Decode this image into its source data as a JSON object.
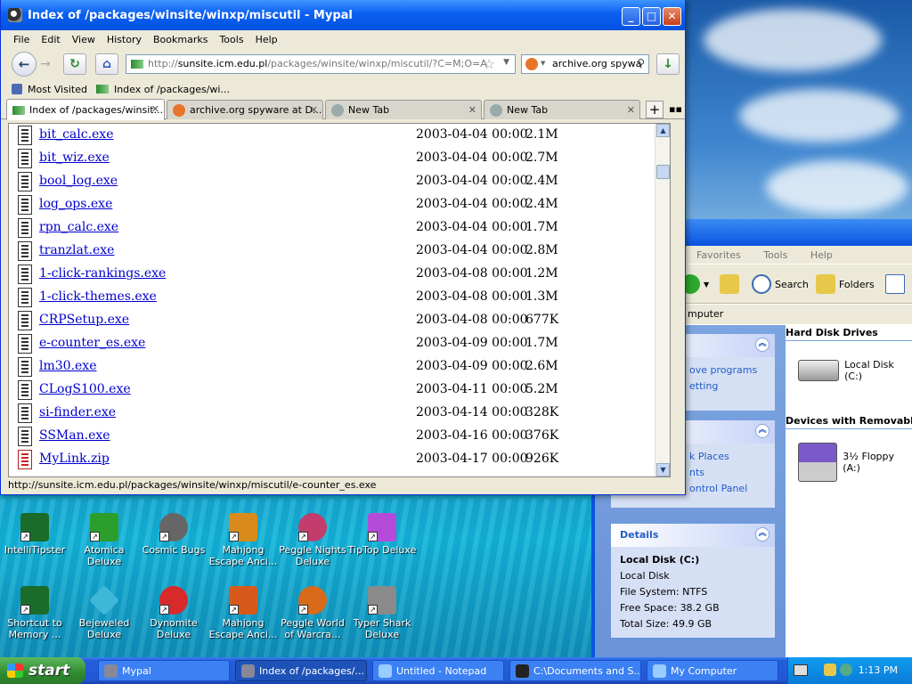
{
  "firefox": {
    "window_title": "Index of /packages/winsite/winxp/miscutil - Mypal",
    "menu": [
      "File",
      "Edit",
      "View",
      "History",
      "Bookmarks",
      "Tools",
      "Help"
    ],
    "url_prefix": "http://",
    "url_host": "sunsite.icm.edu.pl",
    "url_path": "/packages/winsite/winxp/miscutil/?C=M;O=A",
    "search_value": "archive.org spywa",
    "bookmarks": [
      "Most Visited",
      "Index of /packages/wi..."
    ],
    "tabs": [
      {
        "label": "Index of /packages/winsit...",
        "active": true
      },
      {
        "label": "archive.org spyware at D...",
        "active": false
      },
      {
        "label": "New Tab",
        "active": false
      },
      {
        "label": "New Tab",
        "active": false
      }
    ],
    "files": [
      {
        "name": "bit_calc.exe",
        "date": "2003-04-04 00:00",
        "size": "2.1M",
        "kind": "exe"
      },
      {
        "name": "bit_wiz.exe",
        "date": "2003-04-04 00:00",
        "size": "2.7M",
        "kind": "exe"
      },
      {
        "name": "bool_log.exe",
        "date": "2003-04-04 00:00",
        "size": "2.4M",
        "kind": "exe"
      },
      {
        "name": "log_ops.exe",
        "date": "2003-04-04 00:00",
        "size": "2.4M",
        "kind": "exe"
      },
      {
        "name": "rpn_calc.exe",
        "date": "2003-04-04 00:00",
        "size": "1.7M",
        "kind": "exe"
      },
      {
        "name": "tranzlat.exe",
        "date": "2003-04-04 00:00",
        "size": "2.8M",
        "kind": "exe"
      },
      {
        "name": "1-click-rankings.exe",
        "date": "2003-04-08 00:00",
        "size": "1.2M",
        "kind": "exe"
      },
      {
        "name": "1-click-themes.exe",
        "date": "2003-04-08 00:00",
        "size": "1.3M",
        "kind": "exe"
      },
      {
        "name": "CRPSetup.exe",
        "date": "2003-04-08 00:00",
        "size": "677K",
        "kind": "exe"
      },
      {
        "name": "e-counter_es.exe",
        "date": "2003-04-09 00:00",
        "size": "1.7M",
        "kind": "exe"
      },
      {
        "name": "lm30.exe",
        "date": "2003-04-09 00:00",
        "size": "2.6M",
        "kind": "exe"
      },
      {
        "name": "CLogS100.exe",
        "date": "2003-04-11 00:00",
        "size": "5.2M",
        "kind": "exe"
      },
      {
        "name": "si-finder.exe",
        "date": "2003-04-14 00:00",
        "size": "328K",
        "kind": "exe"
      },
      {
        "name": "SSMan.exe",
        "date": "2003-04-16 00:00",
        "size": "376K",
        "kind": "exe"
      },
      {
        "name": "MyLink.zip",
        "date": "2003-04-17 00:00",
        "size": "926K",
        "kind": "zip"
      }
    ],
    "status_text": "http://sunsite.icm.edu.pl/packages/winsite/winxp/miscutil/e-counter_es.exe"
  },
  "mycomputer": {
    "menu": [
      "Favorites",
      "Tools",
      "Help"
    ],
    "toolbar": {
      "search": "Search",
      "folders": "Folders"
    },
    "address": "mputer",
    "tasks_panel": {
      "items": [
        "ove programs",
        "etting"
      ]
    },
    "places_panel": {
      "items": [
        "k Places",
        "nts",
        "ontrol Panel"
      ]
    },
    "details": {
      "title": "Details",
      "name": "Local Disk (C:)",
      "type": "Local Disk",
      "filesystem": "File System: NTFS",
      "free": "Free Space: 38.2 GB",
      "total": "Total Size: 49.9 GB"
    },
    "group_hdd": "Hard Disk Drives",
    "drive_c": "Local Disk (C:)",
    "group_removable": "Devices with Removabl",
    "drive_a": "3½ Floppy (A:)"
  },
  "desktop_icons": [
    {
      "label": "IntelliTipster",
      "color": "#1b6b2a"
    },
    {
      "label": "Atomica Deluxe",
      "color": "#2c9e2c"
    },
    {
      "label": "Cosmic Bugs",
      "color": "#666666"
    },
    {
      "label": "Mahjong Escape Anci...",
      "color": "#d88a1a"
    },
    {
      "label": "Peggle Nights Deluxe",
      "color": "#c23d6b"
    },
    {
      "label": "TipTop Deluxe",
      "color": "#b44bd8"
    },
    {
      "label": "Shortcut to Memory ...",
      "color": "#1b6b2a"
    },
    {
      "label": "Bejeweled Deluxe",
      "color": "#3fb8d8"
    },
    {
      "label": "Dynomite Deluxe",
      "color": "#d82a2a"
    },
    {
      "label": "Mahjong Escape Anci...",
      "color": "#d85a1a"
    },
    {
      "label": "Peggle World of Warcra...",
      "color": "#d86a1a"
    },
    {
      "label": "Typer Shark Deluxe",
      "color": "#8a8a8a"
    }
  ],
  "taskbar": {
    "start": "start",
    "tasks": [
      {
        "label": "Mypal",
        "active": false
      },
      {
        "label": "Index of /packages/...",
        "active": true
      },
      {
        "label": "Untitled - Notepad",
        "active": false
      },
      {
        "label": "C:\\Documents and S...",
        "active": false
      },
      {
        "label": "My Computer",
        "active": false
      }
    ],
    "clock": "1:13 PM"
  }
}
